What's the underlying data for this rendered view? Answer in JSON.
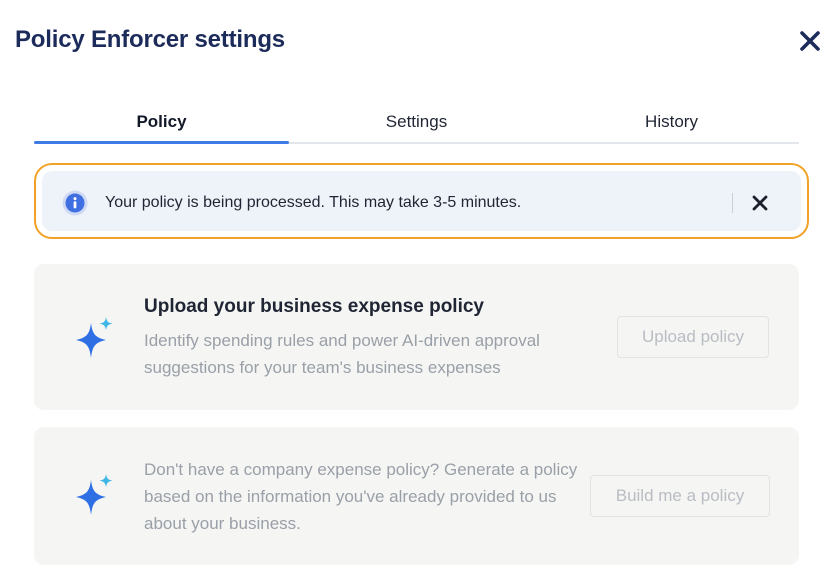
{
  "header": {
    "title": "Policy Enforcer settings",
    "close_icon": "close-icon"
  },
  "tabs": [
    {
      "label": "Policy",
      "active": true
    },
    {
      "label": "Settings",
      "active": false
    },
    {
      "label": "History",
      "active": false
    }
  ],
  "notice": {
    "icon": "info-icon",
    "text": "Your policy is being processed. This may take 3-5 minutes.",
    "dismiss_icon": "close-icon"
  },
  "cards": [
    {
      "icon": "sparkle-icon",
      "title": "Upload your business expense policy",
      "description": "Identify spending rules and power AI-driven approval suggestions for your team's business expenses",
      "button_label": "Upload policy"
    },
    {
      "icon": "sparkle-icon",
      "description": "Don't have a company expense policy? Generate a policy based on the information you've already provided to us about your business.",
      "button_label": "Build me a policy"
    }
  ],
  "colors": {
    "title": "#1c2b5a",
    "tab_underline": "#3f7be6",
    "notice_outline": "#f2a227",
    "notice_bg": "#eef3f9",
    "info_icon": "#3f6fe0",
    "card_bg": "#f5f5f4",
    "sparkle_primary": "#2f6fe4",
    "sparkle_secondary": "#3fb7e6"
  }
}
